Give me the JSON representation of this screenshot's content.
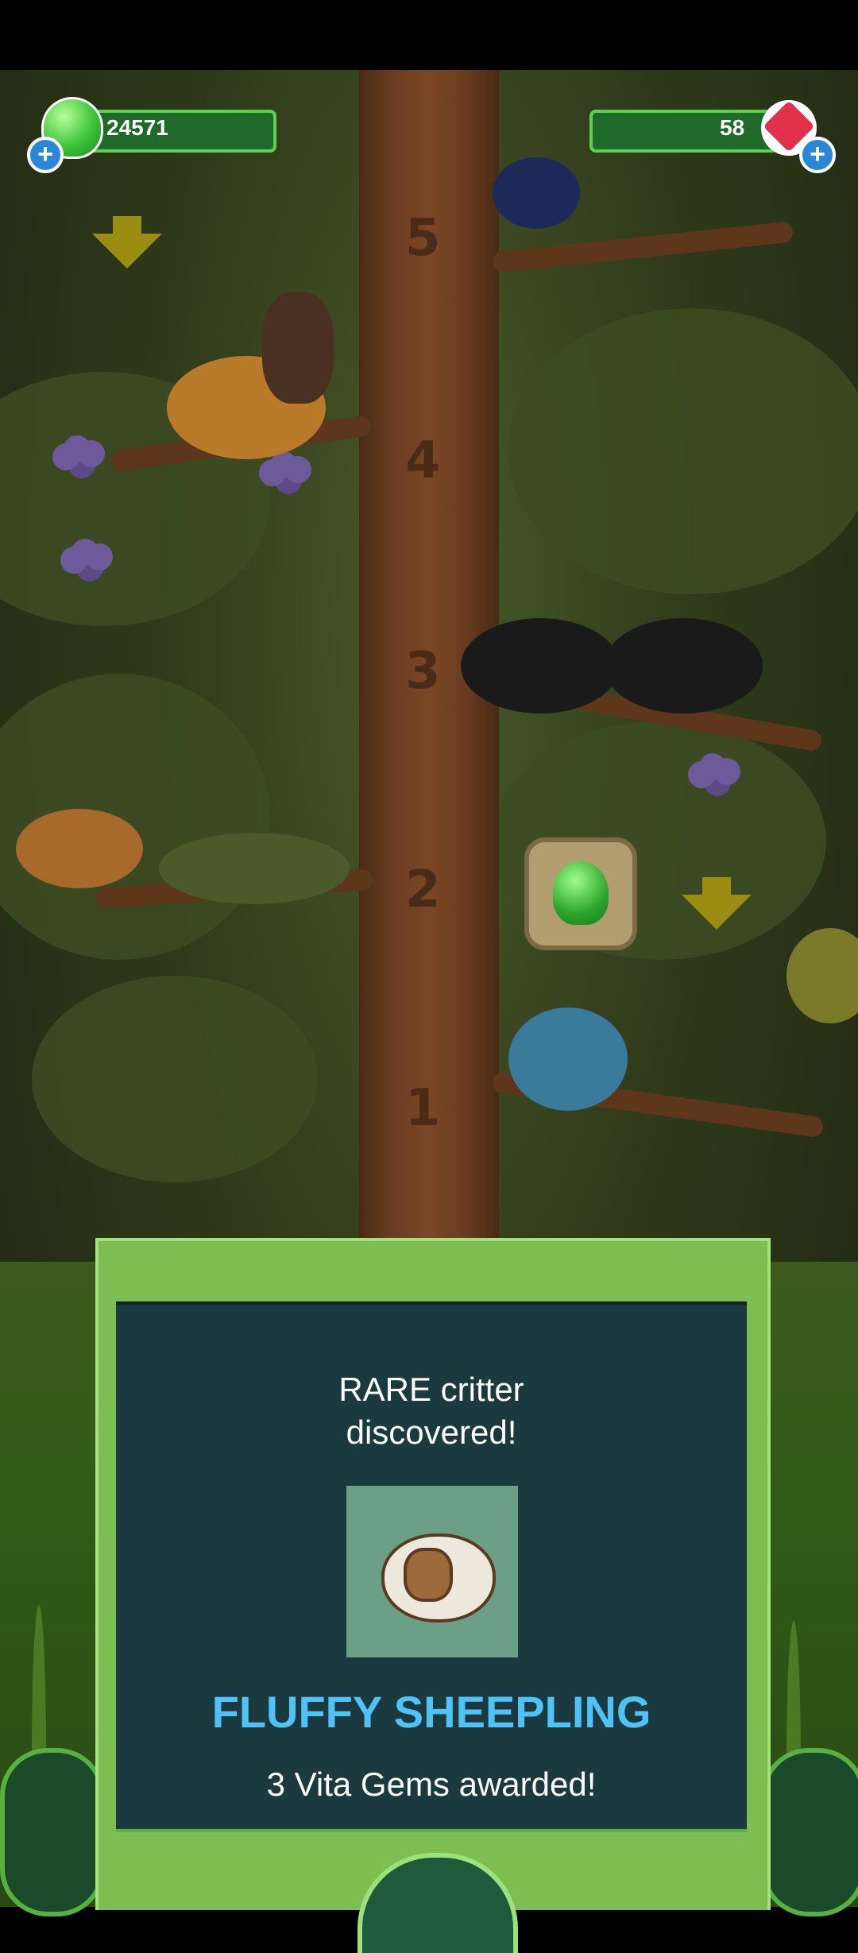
{
  "hud": {
    "green_gems": "24571",
    "vita_gems": "58"
  },
  "tree": {
    "levels": [
      "5",
      "4",
      "3",
      "2",
      "1"
    ]
  },
  "dialog": {
    "headline": "RARE critter discovered!",
    "critter_name": "FLUFFY SHEEPLING",
    "award_text": "3 Vita Gems awarded!"
  },
  "icons": {
    "currency_left": "green-gem-icon",
    "currency_right": "vita-gem-icon",
    "plus": "plus-icon",
    "down_arrow": "down-arrow-icon"
  },
  "colors": {
    "dialog_bg": "#1b3a3f",
    "dialog_frame": "#7dbd52",
    "critter_name": "#4fc3f7",
    "hud_bar": "#1f6a2a"
  }
}
